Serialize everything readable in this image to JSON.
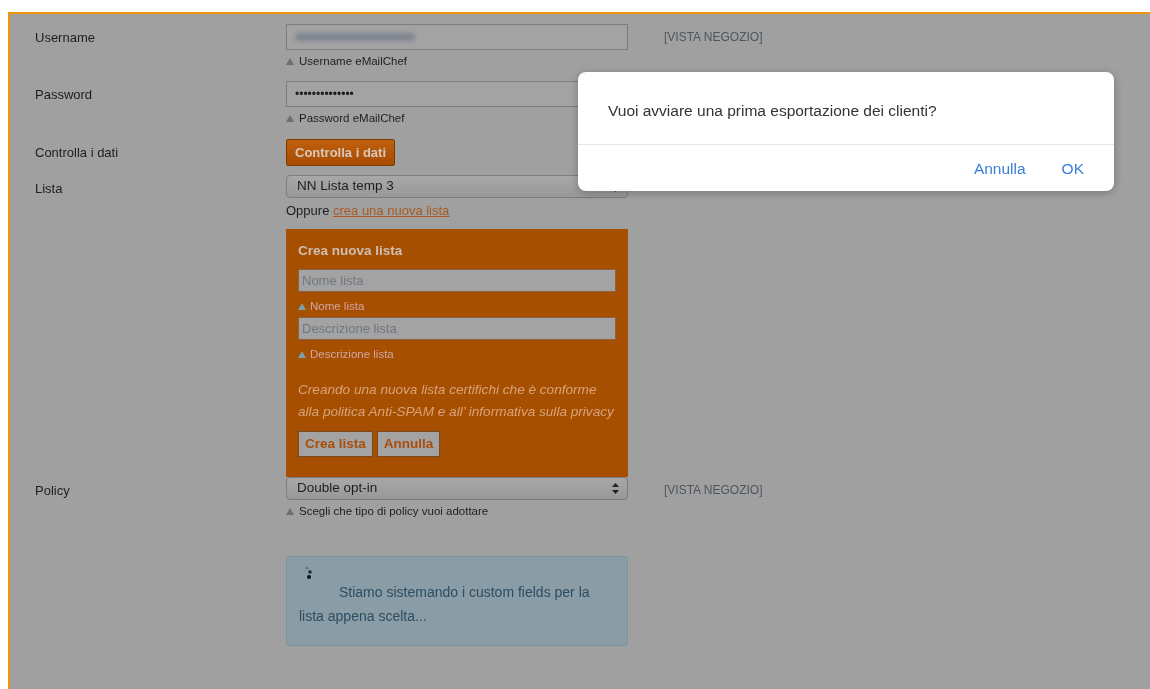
{
  "form": {
    "rows": [
      {
        "kind": "text",
        "label": "Username",
        "masked": true,
        "hint": "Username eMailChef",
        "side": "[VISTA NEGOZIO]"
      },
      {
        "kind": "text",
        "label": "Password",
        "value": "••••••••••••••",
        "hint": "Password eMailChef"
      },
      {
        "kind": "button",
        "label": "Controlla i dati",
        "button": "Controlla i dati"
      },
      {
        "kind": "select",
        "label": "Lista",
        "value": "NN Lista temp 3",
        "alt_prefix": "Oppure",
        "alt_link": "crea una nuova lista",
        "new_list": {
          "title": "Crea nuova lista",
          "fields": [
            {
              "placeholder": "Nome lista",
              "hint": "Nome lista"
            },
            {
              "placeholder": "Descrizione lista",
              "hint": "Descrizione lista"
            }
          ],
          "notice": "Creando una nuova lista certifichi che è conforme alla politica Anti-SPAM e all’ informativa sulla privacy",
          "buttons": [
            "Crea lista",
            "Annulla"
          ]
        }
      },
      {
        "kind": "select",
        "label": "Policy",
        "value": "Double opt-in",
        "side": "[VISTA NEGOZIO]",
        "hint": "Scegli che tipo di policy vuoi adottare",
        "info": "Stiamo sistemando i custom fields per la lista appena scelta..."
      }
    ]
  },
  "dialog": {
    "message": "Vuoi avviare una prima esportazione dei clienti?",
    "buttons": [
      "Annulla",
      "OK"
    ]
  }
}
